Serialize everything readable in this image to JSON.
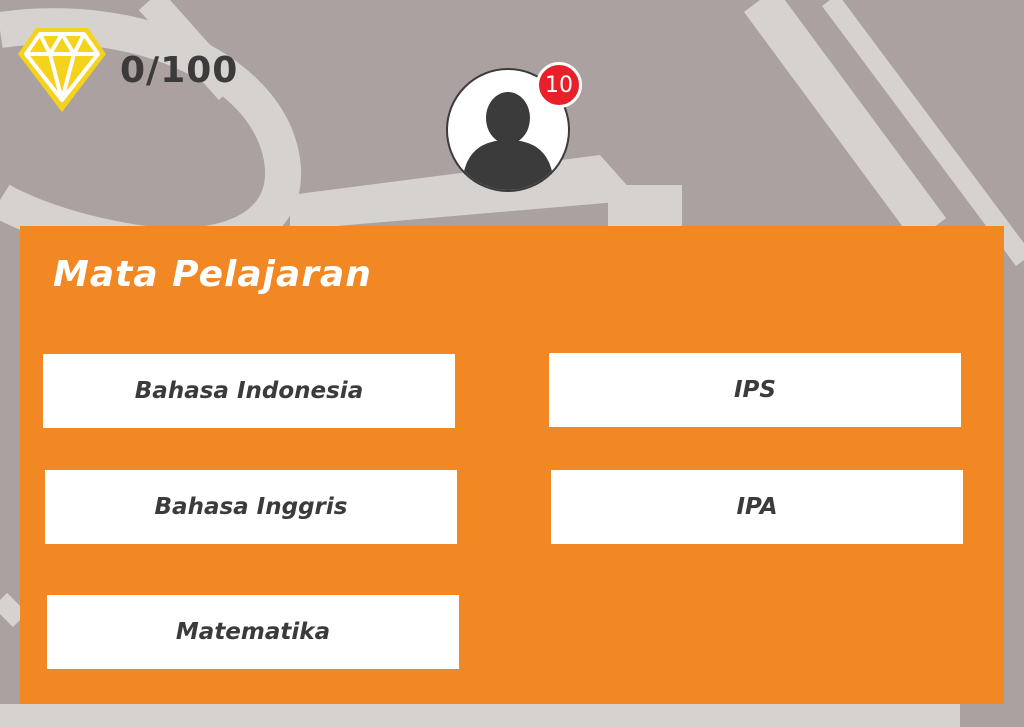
{
  "score": {
    "text": "0/100",
    "icon": "diamond-icon",
    "color": "#f5d31c"
  },
  "profile": {
    "icon": "user-silhouette-icon",
    "notification_count": "10",
    "badge_color": "#e8202a"
  },
  "panel": {
    "title": "Mata Pelajaran",
    "color": "#f28823",
    "subjects": [
      {
        "label": "Bahasa Indonesia"
      },
      {
        "label": "IPS"
      },
      {
        "label": "Bahasa Inggris"
      },
      {
        "label": "IPA"
      },
      {
        "label": "Matematika"
      }
    ]
  }
}
